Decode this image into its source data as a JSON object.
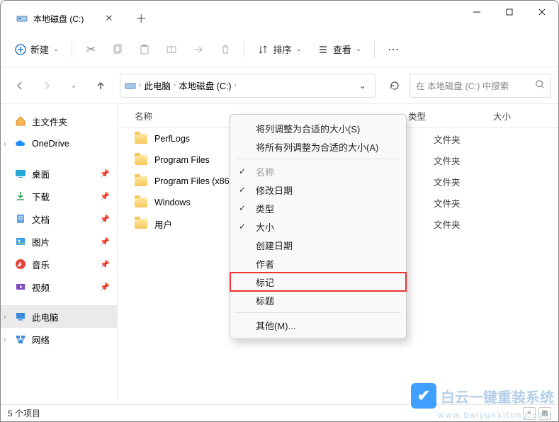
{
  "window": {
    "tab_title": "本地磁盘 (C:)"
  },
  "toolbar": {
    "new_label": "新建",
    "sort_label": "排序",
    "view_label": "查看"
  },
  "breadcrumb": {
    "root": "此电脑",
    "current": "本地磁盘 (C:)"
  },
  "search": {
    "placeholder": "在 本地磁盘 (C:) 中搜索"
  },
  "columns": {
    "name": "名称",
    "type": "类型",
    "size": "大小"
  },
  "sidebar": {
    "home": "主文件夹",
    "onedrive": "OneDrive",
    "desktop": "桌面",
    "downloads": "下载",
    "documents": "文档",
    "pictures": "图片",
    "music": "音乐",
    "videos": "视频",
    "thispc": "此电脑",
    "network": "网络"
  },
  "files": [
    {
      "name": "PerfLogs",
      "type": "文件夹"
    },
    {
      "name": "Program Files",
      "type": "文件夹"
    },
    {
      "name": "Program Files (x86)",
      "type": "文件夹"
    },
    {
      "name": "Windows",
      "type": "文件夹"
    },
    {
      "name": "用户",
      "type": "文件夹"
    }
  ],
  "context_menu": {
    "fit_column": "将列调整为合适的大小(S)",
    "fit_all": "将所有列调整为合适的大小(A)",
    "name": "名称",
    "modified": "修改日期",
    "type": "类型",
    "size": "大小",
    "created": "创建日期",
    "author": "作者",
    "tags": "标记",
    "title": "标题",
    "other": "其他(M)..."
  },
  "status": {
    "item_count": "5 个项目"
  },
  "watermark": {
    "text": "白云一键重装系统",
    "url": "www.baiyunxitong.com"
  }
}
